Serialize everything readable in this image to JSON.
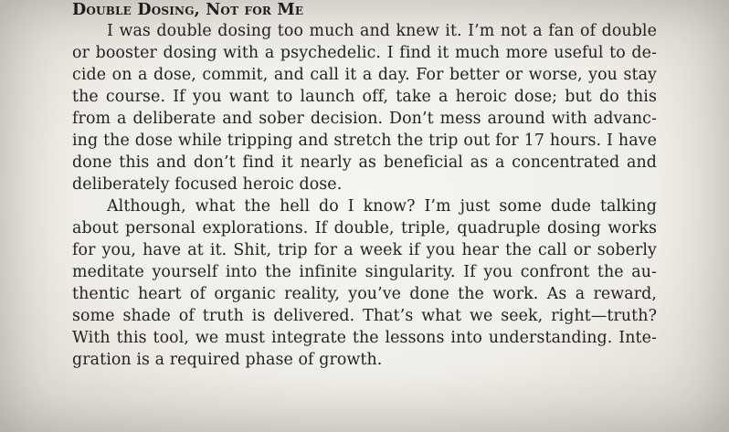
{
  "section": {
    "heading": "Double Dosing, Not for Me"
  },
  "paragraphs": [
    {
      "lines": [
        "I was double dosing too much and knew it. I’m not a fan of double",
        "or booster dosing with a psychedelic. I find it much more useful to de-",
        "cide on a dose, commit, and call it a day. For better or worse, you stay",
        "the course. If you want to launch off, take a heroic dose; but do this",
        "from a deliberate and sober decision. Don’t mess around with advanc-",
        "ing the dose while tripping and stretch the trip out for 17 hours. I have",
        "done this and don’t find it nearly as beneficial as a concentrated and",
        "deliberately focused heroic dose."
      ]
    },
    {
      "lines": [
        "Although, what the hell do I know? I’m just some dude talking",
        "about personal explorations. If double, triple, quadruple dosing works",
        "for you, have at it. Shit, trip for a week if you hear the call or soberly",
        "meditate yourself into the infinite singularity. If you confront the au-",
        "thentic heart of organic reality, you’ve done the work. As a reward,",
        "some shade of truth is delivered. That’s what we seek, right—truth?",
        "With this tool, we must integrate the lessons into understanding. Inte-",
        "gration is a required phase of growth."
      ]
    }
  ]
}
